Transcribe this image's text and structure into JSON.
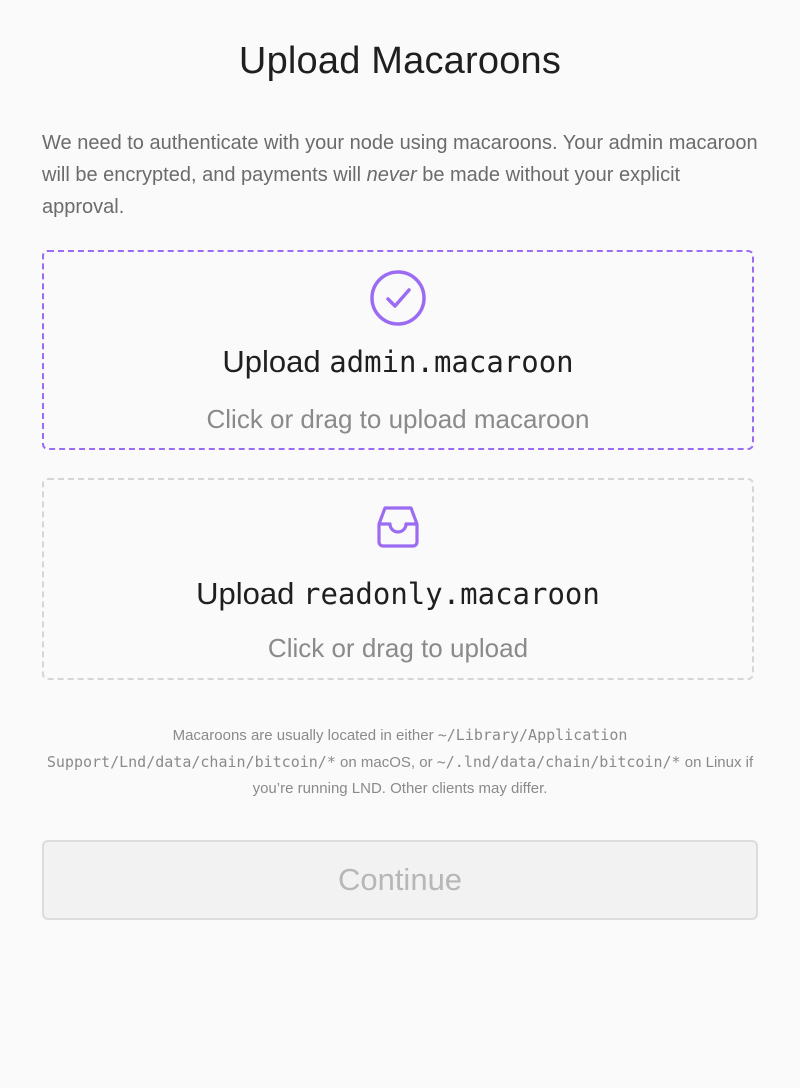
{
  "title": "Upload Macaroons",
  "intro": {
    "before": "We need to authenticate with your node using macaroons. Your admin macaroon will be encrypted, and payments will ",
    "emphasis": "never",
    "after": " be made without your explicit approval."
  },
  "admin_upload": {
    "status": "uploaded",
    "icon": "check-circle-icon",
    "label_prefix": "Upload ",
    "filename": "admin.macaroon",
    "hint": "Click or drag to upload macaroon",
    "accent_color": "#9b6cf2"
  },
  "readonly_upload": {
    "status": "empty",
    "icon": "inbox-icon",
    "label_prefix": "Upload ",
    "filename": "readonly.macaroon",
    "hint": "Click or drag to upload",
    "border_color": "#d6d6d6"
  },
  "note": {
    "part1": "Macaroons are usually located in either ",
    "path_macos": "~/Library/Application Support/Lnd/data/chain/bitcoin/*",
    "part2": " on macOS, or ",
    "path_linux": "~/.lnd/data/chain/bitcoin/*",
    "part3": " on Linux if you’re running LND. Other clients may differ."
  },
  "continue_button": {
    "label": "Continue",
    "disabled": true
  },
  "colors": {
    "accent": "#9b6cf2",
    "muted_text": "#8a8a8a",
    "background": "#fafafa"
  }
}
